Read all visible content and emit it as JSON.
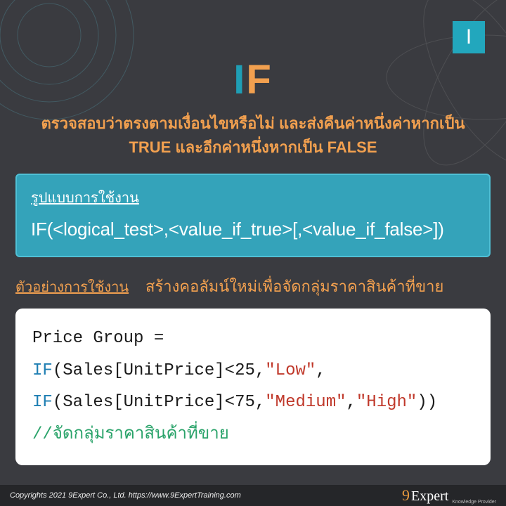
{
  "badge": "I",
  "title": {
    "left": "I",
    "right": "F"
  },
  "subtitle": "ตรวจสอบว่าตรงตามเงื่อนไขหรือไม่ และส่งคืนค่าหนึ่งค่าหากเป็น TRUE และอีกค่าหนึ่งหากเป็น FALSE",
  "syntax": {
    "label": "รูปแบบการใช้งาน",
    "text": "IF(<logical_test>,<value_if_true>[,<value_if_false>])"
  },
  "example": {
    "label": "ตัวอย่างการใช้งาน",
    "desc": "สร้างคอลัมน์ใหม่เพื่อจัดกลุ่มราคาสินค้าที่ขาย"
  },
  "code": {
    "line1_a": "Price Group =",
    "line2_kw": "IF",
    "line2_a": "(Sales[UnitPrice]<",
    "line2_num": "25",
    "line2_b": ",",
    "line2_str": "\"Low\"",
    "line2_c": ",",
    "line3_kw": "IF",
    "line3_a": "(Sales[UnitPrice]<",
    "line3_num": "75",
    "line3_b": ",",
    "line3_str1": "\"Medium\"",
    "line3_c": ",",
    "line3_str2": "\"High\"",
    "line3_d": "))",
    "comment": "//จัดกลุ่มราคาสินค้าที่ขาย"
  },
  "footer": {
    "copyright": "Copyrights 2021 9Expert Co., Ltd.   https://www.9ExpertTraining.com",
    "logo_num": "9",
    "logo_text": "Expert",
    "logo_sub": "Knowledge Provider"
  }
}
